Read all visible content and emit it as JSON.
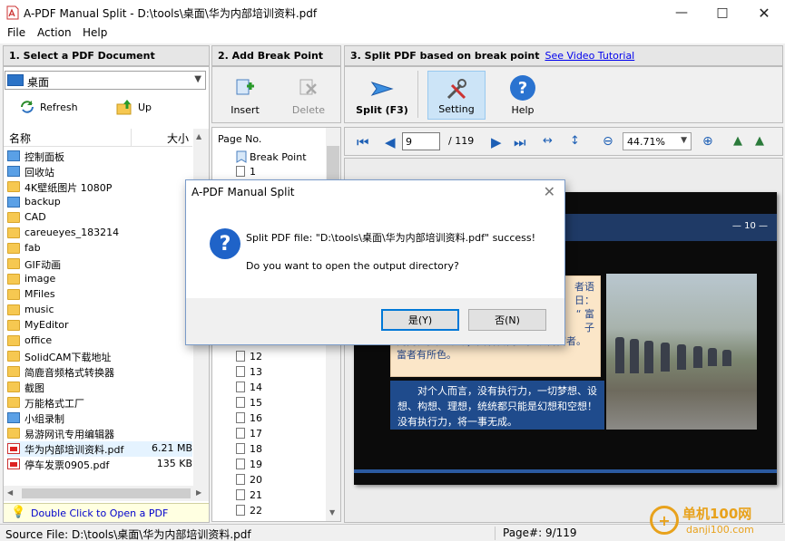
{
  "window": {
    "title": "A-PDF Manual Split - D:\\tools\\桌面\\华为内部培训资料.pdf"
  },
  "menu": [
    "File",
    "Action",
    "Help"
  ],
  "panel1": {
    "header": "1. Select a PDF Document",
    "location": "桌面",
    "refresh_label": "Refresh",
    "up_label": "Up",
    "col_name": "名称",
    "col_size": "大小",
    "items": [
      {
        "name": "控制面板",
        "size": "",
        "kind": "system"
      },
      {
        "name": "回收站",
        "size": "",
        "kind": "system"
      },
      {
        "name": "4K壁纸图片 1080P",
        "size": "",
        "kind": "folder"
      },
      {
        "name": "backup",
        "size": "",
        "kind": "system"
      },
      {
        "name": "CAD",
        "size": "",
        "kind": "folder"
      },
      {
        "name": "careueyes_183214",
        "size": "",
        "kind": "folder"
      },
      {
        "name": "fab",
        "size": "",
        "kind": "folder"
      },
      {
        "name": "GIF动画",
        "size": "",
        "kind": "folder"
      },
      {
        "name": "image",
        "size": "",
        "kind": "folder"
      },
      {
        "name": "MFiles",
        "size": "",
        "kind": "folder"
      },
      {
        "name": "music",
        "size": "",
        "kind": "folder"
      },
      {
        "name": "MyEditor",
        "size": "",
        "kind": "folder"
      },
      {
        "name": "office",
        "size": "",
        "kind": "folder"
      },
      {
        "name": "SolidCAM下载地址",
        "size": "",
        "kind": "folder"
      },
      {
        "name": "简鹿音频格式转换器",
        "size": "",
        "kind": "folder"
      },
      {
        "name": "截图",
        "size": "",
        "kind": "folder"
      },
      {
        "name": "万能格式工厂",
        "size": "",
        "kind": "folder"
      },
      {
        "name": "小组录制",
        "size": "",
        "kind": "system"
      },
      {
        "name": "易游网讯专用编辑器",
        "size": "",
        "kind": "folder"
      },
      {
        "name": "华为内部培训资料.pdf",
        "size": "6.21 MB",
        "kind": "pdf"
      },
      {
        "name": "停车发票0905.pdf",
        "size": "135 KB",
        "kind": "pdf"
      }
    ],
    "hint": "Double Click to Open a PDF"
  },
  "panel2": {
    "header": "2. Add Break Point",
    "insert_label": "Insert",
    "delete_label": "Delete",
    "page_no_label": "Page No.",
    "break_point_label": "Break Point",
    "pages": [
      "1",
      "12",
      "13",
      "14",
      "15",
      "16",
      "17",
      "18",
      "19",
      "20",
      "21",
      "22"
    ]
  },
  "panel3": {
    "header": "3. Split PDF based on break point",
    "video_link": "See Video Tutorial",
    "split_label": "Split (F3)",
    "setting_label": "Setting",
    "help_label": "Help",
    "current_page": "9",
    "total_pages": "/ 119",
    "zoom": "44.71%"
  },
  "slide": {
    "page_number": "— 10 —",
    "quote_lines": [
      "者语",
      "日：",
      "“ 富",
      "子",
      "同而往，起那斗；贫者自而远，以吉富者。",
      "富者有所色。"
    ],
    "blue_lines": [
      "对个人而言，没有执行力，一切梦想、设",
      "想、构想、理想，统统都只能是幻想和空想！",
      "没有执行力，将一事无成。"
    ]
  },
  "dialog": {
    "title": "A-PDF Manual Split",
    "message_1": "Split PDF file: \"D:\\tools\\桌面\\华为内部培训资料.pdf\" success!",
    "message_2": "Do you want to open the output directory?",
    "yes_label": "是(Y)",
    "no_label": "否(N)"
  },
  "status": {
    "source": "Source File: D:\\tools\\桌面\\华为内部培训资料.pdf",
    "page": "Page#: 9/119"
  },
  "watermark": {
    "brand": "单机100网",
    "url": "danji100.com"
  }
}
